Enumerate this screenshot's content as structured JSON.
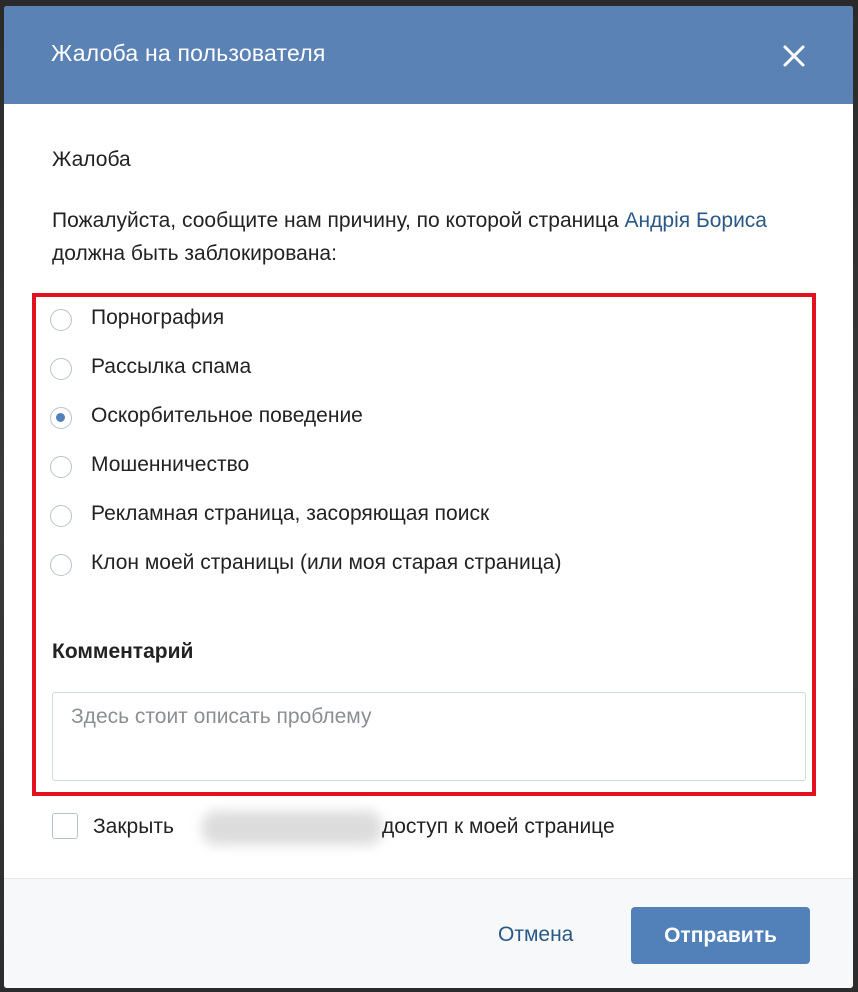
{
  "dialog": {
    "title": "Жалоба на пользователя",
    "close_icon": "close-icon"
  },
  "complaint": {
    "section_title": "Жалоба",
    "description_prefix": "Пожалуйста, сообщите нам причину, по которой страница ",
    "user_name": "Андрія Бориса",
    "description_suffix": " должна быть заблокирована:"
  },
  "reasons": {
    "selected_index": 2,
    "items": [
      {
        "label": "Порнография",
        "checked": false
      },
      {
        "label": "Рассылка спама",
        "checked": false
      },
      {
        "label": "Оскорбительное поведение",
        "checked": true
      },
      {
        "label": "Мошенничество",
        "checked": false
      },
      {
        "label": "Рекламная страница, засоряющая поиск",
        "checked": false
      },
      {
        "label": "Клон моей страницы (или моя старая страница)",
        "checked": false
      }
    ]
  },
  "comment": {
    "label": "Комментарий",
    "value": "",
    "placeholder": "Здесь стоит описать проблему"
  },
  "restrict_access": {
    "checked": false,
    "text_before": "Закрыть",
    "text_after": "доступ к моей странице"
  },
  "footer": {
    "cancel_label": "Отмена",
    "submit_label": "Отправить"
  },
  "colors": {
    "header_bg": "#5b82b5",
    "accent": "#5181b8",
    "link": "#2a5885",
    "highlight_border": "#e3101f"
  }
}
